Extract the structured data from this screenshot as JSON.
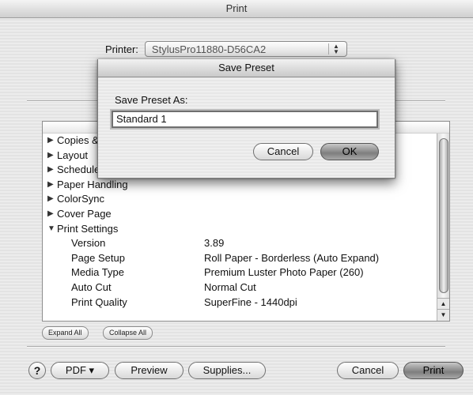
{
  "window": {
    "title": "Print"
  },
  "printer": {
    "label": "Printer:",
    "value": "StylusPro11880-D56CA2"
  },
  "tree": {
    "sections": [
      {
        "label": "Copies & Pages",
        "expanded": false
      },
      {
        "label": "Layout",
        "expanded": false
      },
      {
        "label": "Scheduler",
        "expanded": false
      },
      {
        "label": "Paper Handling",
        "expanded": false
      },
      {
        "label": "ColorSync",
        "expanded": false
      },
      {
        "label": "Cover Page",
        "expanded": false
      },
      {
        "label": "Print Settings",
        "expanded": true
      }
    ],
    "details": [
      {
        "key": "Version",
        "value": "3.89"
      },
      {
        "key": "Page Setup",
        "value": "Roll Paper - Borderless (Auto Expand)"
      },
      {
        "key": "Media Type",
        "value": "Premium Luster Photo Paper (260)"
      },
      {
        "key": "Auto Cut",
        "value": "Normal Cut"
      },
      {
        "key": "Print Quality",
        "value": "SuperFine - 1440dpi"
      }
    ]
  },
  "tree_buttons": {
    "expand_all": "Expand All",
    "collapse_all": "Collapse All"
  },
  "bottom": {
    "help": "?",
    "pdf": "PDF ▾",
    "preview": "Preview",
    "supplies": "Supplies...",
    "cancel": "Cancel",
    "print": "Print"
  },
  "sheet": {
    "title": "Save Preset",
    "label": "Save Preset As:",
    "input_value": "Standard 1",
    "cancel": "Cancel",
    "ok": "OK"
  }
}
